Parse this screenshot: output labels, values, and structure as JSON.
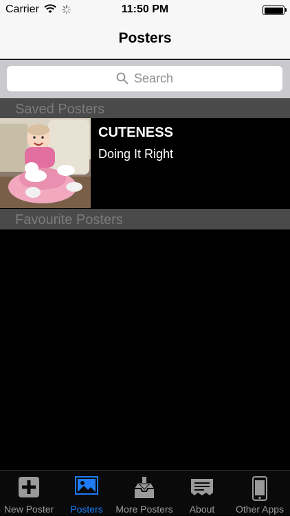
{
  "status_bar": {
    "carrier": "Carrier",
    "time": "11:50 PM"
  },
  "nav": {
    "title": "Posters"
  },
  "search": {
    "placeholder": "Search"
  },
  "sections": [
    {
      "title": "Saved Posters"
    },
    {
      "title": "Favourite Posters"
    }
  ],
  "saved": [
    {
      "title": "CUTENESS",
      "subtitle": "Doing It Right"
    }
  ],
  "tabs": [
    {
      "label": "New Poster",
      "icon": "plus-square-icon"
    },
    {
      "label": "Posters",
      "icon": "image-icon",
      "active": true
    },
    {
      "label": "More Posters",
      "icon": "download-tray-icon"
    },
    {
      "label": "About",
      "icon": "receipt-icon"
    },
    {
      "label": "Other Apps",
      "icon": "phone-icon"
    }
  ],
  "colors": {
    "accent": "#1e7bf5",
    "section_bg": "#4a4a4a",
    "bar_bg": "#f7f7f7"
  }
}
